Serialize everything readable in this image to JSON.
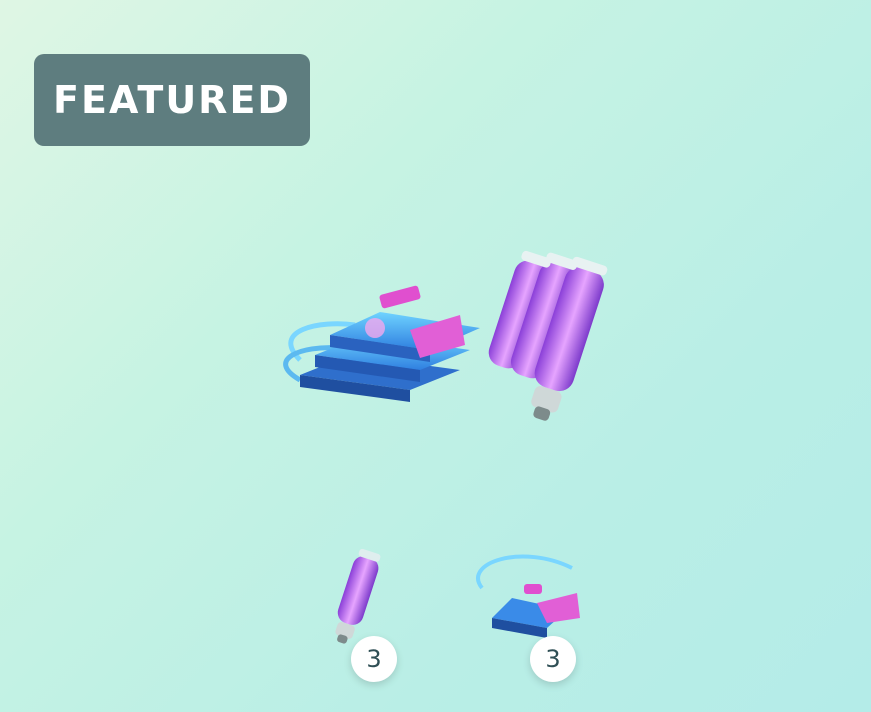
{
  "badge": {
    "label": "FEATURED"
  },
  "items": [
    {
      "name": "star-piece-icon",
      "count": "3"
    },
    {
      "name": "incense-pack-icon",
      "count": "3"
    }
  ],
  "hero": {
    "name": "incense-bundle-icon"
  },
  "colors": {
    "badge": "#5e7d7f",
    "accent_purple": "#b86cf0",
    "accent_blue": "#3a8be8",
    "count_text": "#2f4f55"
  }
}
